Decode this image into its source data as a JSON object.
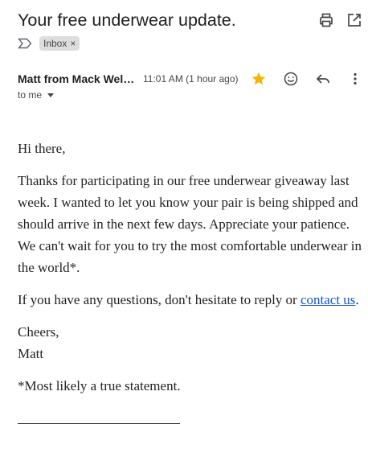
{
  "email": {
    "subject": "Your free underwear update.",
    "label": "Inbox",
    "label_close": "×",
    "sender": "Matt from Mack Weldon",
    "time": "11:01 AM (1 hour ago)",
    "recipient": "to me",
    "star_color": "#f4b400"
  },
  "body": {
    "greeting": "Hi there,",
    "paragraph1": "Thanks for participating in our free underwear giveaway last week. I wanted to let you know your pair is being shipped and should arrive in the next few days. Appreciate your patience. We can't wait for you to try the most comfortable underwear in the world*.",
    "paragraph2_before": "If you have any questions, don't hesitate to reply or ",
    "paragraph2_link": "contact us",
    "paragraph2_after": ".",
    "signoff": "Cheers,",
    "signature": "Matt",
    "footnote": "*Most likely a true statement."
  },
  "icons": {
    "print": "printer-icon",
    "new_window": "open-in-new-window-icon",
    "important": "importance-marker-icon",
    "star": "star-icon",
    "emoji": "emoji-icon",
    "reply": "reply-icon",
    "more": "more-vert-icon"
  }
}
